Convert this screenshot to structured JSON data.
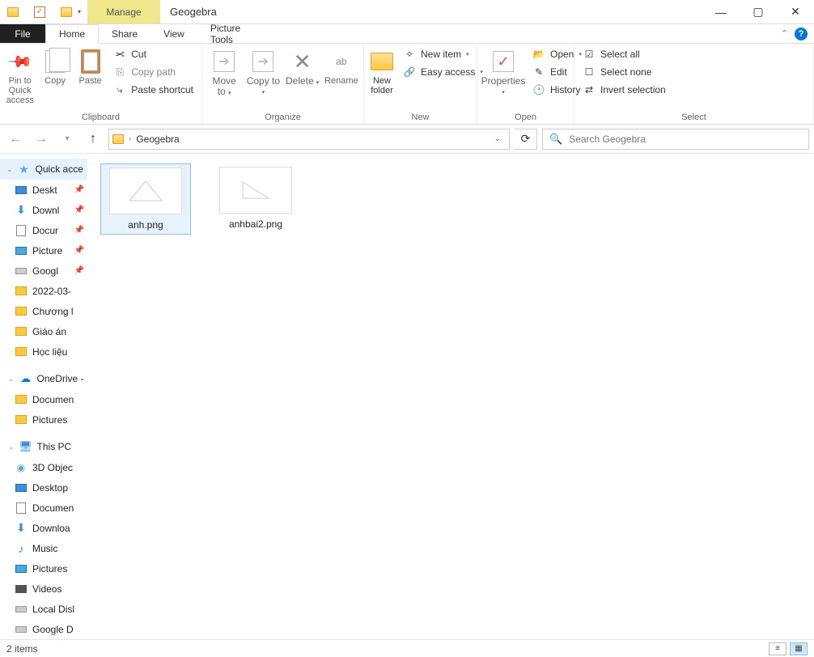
{
  "title": "Geogebra",
  "titlebar": {
    "manage": "Manage"
  },
  "tabs": {
    "file": "File",
    "home": "Home",
    "share": "Share",
    "view": "View",
    "picture_tools": "Picture Tools"
  },
  "ribbon": {
    "clipboard": {
      "label": "Clipboard",
      "pin": "Pin to Quick access",
      "copy": "Copy",
      "paste": "Paste",
      "cut": "Cut",
      "copy_path": "Copy path",
      "paste_shortcut": "Paste shortcut"
    },
    "organize": {
      "label": "Organize",
      "move_to": "Move to",
      "copy_to": "Copy to",
      "delete": "Delete",
      "rename": "Rename"
    },
    "new": {
      "label": "New",
      "new_folder": "New folder",
      "new_item": "New item",
      "easy_access": "Easy access"
    },
    "open": {
      "label": "Open",
      "properties": "Properties",
      "open": "Open",
      "edit": "Edit",
      "history": "History"
    },
    "select": {
      "label": "Select",
      "select_all": "Select all",
      "select_none": "Select none",
      "invert": "Invert selection"
    }
  },
  "address": {
    "crumb1": "Geogebra",
    "search_placeholder": "Search Geogebra"
  },
  "sidebar": {
    "quick_access": "Quick acce",
    "items_qa": [
      {
        "label": "Deskt",
        "kind": "desktop",
        "pin": true
      },
      {
        "label": "Downl",
        "kind": "download",
        "pin": true
      },
      {
        "label": "Docur",
        "kind": "doc",
        "pin": true
      },
      {
        "label": "Picture",
        "kind": "pic",
        "pin": true
      },
      {
        "label": "Googl",
        "kind": "drive",
        "pin": true
      },
      {
        "label": "2022-03-",
        "kind": "folder",
        "pin": false
      },
      {
        "label": "Chương l",
        "kind": "folder",
        "pin": false
      },
      {
        "label": "Giáo án",
        "kind": "folder",
        "pin": false
      },
      {
        "label": "Học liệu",
        "kind": "folder",
        "pin": false
      }
    ],
    "onedrive": "OneDrive -",
    "items_od": [
      {
        "label": "Documen",
        "kind": "folder"
      },
      {
        "label": "Pictures",
        "kind": "folder"
      }
    ],
    "this_pc": "This PC",
    "items_pc": [
      {
        "label": "3D Objec",
        "kind": "3d"
      },
      {
        "label": "Desktop",
        "kind": "desktop"
      },
      {
        "label": "Documen",
        "kind": "doc"
      },
      {
        "label": "Downloa",
        "kind": "download"
      },
      {
        "label": "Music",
        "kind": "music"
      },
      {
        "label": "Pictures",
        "kind": "pic"
      },
      {
        "label": "Videos",
        "kind": "video"
      },
      {
        "label": "Local Disl",
        "kind": "disk"
      },
      {
        "label": "Google D",
        "kind": "disk"
      }
    ]
  },
  "files": [
    {
      "name": "anh.png",
      "selected": true,
      "shape": "tri1"
    },
    {
      "name": "anhbai2.png",
      "selected": false,
      "shape": "tri2"
    }
  ],
  "status": {
    "count": "2 items"
  }
}
